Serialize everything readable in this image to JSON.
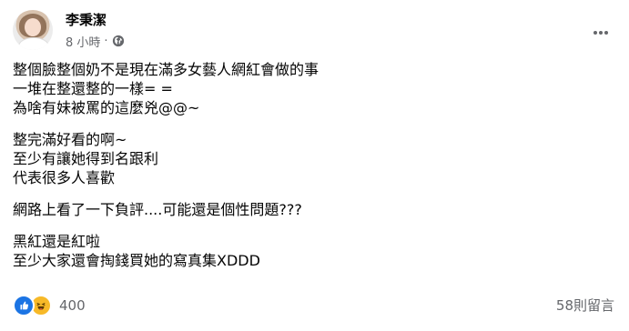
{
  "post": {
    "author": "李秉潔",
    "time": "8 小時",
    "separator": "·",
    "privacy_icon": "globe-icon",
    "more_icon": "more-options-icon",
    "paragraphs": [
      [
        "整個臉整個奶不是現在滿多女藝人網紅會做的事",
        "一堆在整還整的一樣= =",
        "為啥有妹被罵的這麼兇@@~"
      ],
      [
        "整完滿好看的啊~",
        "至少有讓她得到名跟利",
        "代表很多人喜歡"
      ],
      [
        "網路上看了一下負評....可能還是個性問題???"
      ],
      [
        "黑紅還是紅啦",
        "至少大家還會掏錢買她的寫真集XDDD"
      ]
    ],
    "reactions": {
      "icons": [
        "like-icon",
        "haha-icon"
      ],
      "count": "400"
    },
    "comments_label": "58則留言"
  },
  "colors": {
    "text": "#050505",
    "secondary": "#65676b",
    "like_blue": "#1b74e4",
    "haha_yellow": "#f7b928"
  }
}
